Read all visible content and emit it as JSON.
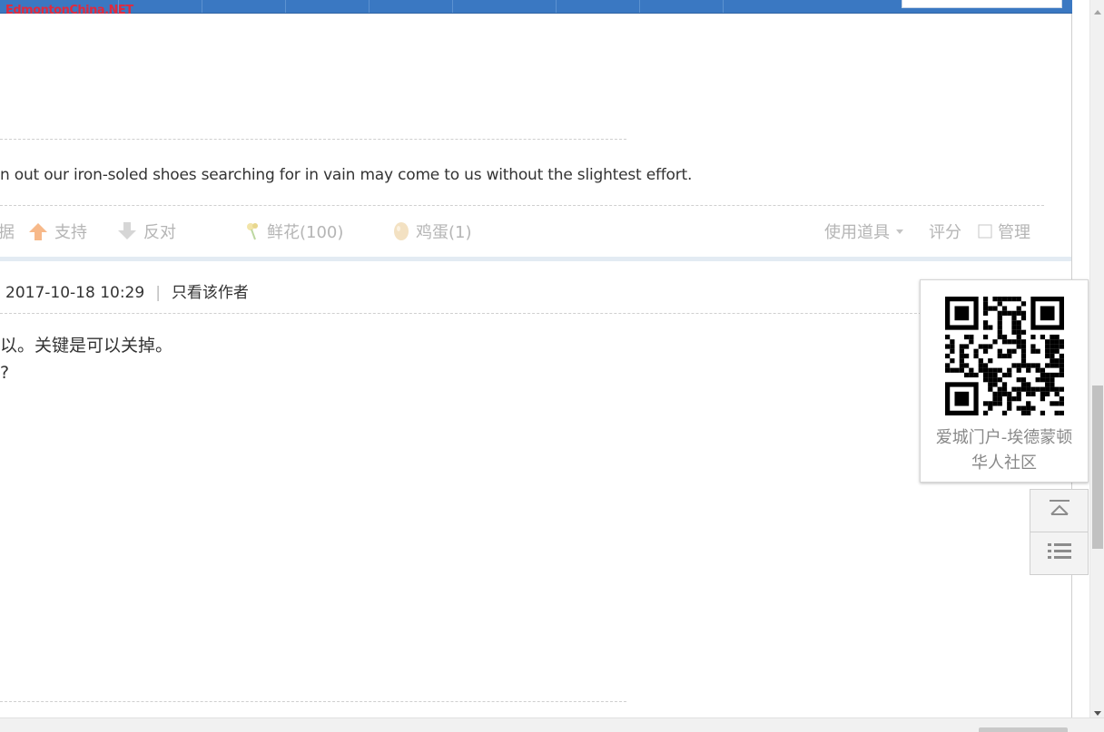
{
  "site": {
    "watermark": "EdmontonChina.NET"
  },
  "post": {
    "signature": "n out our iron-soled shoes searching for in vain may come to us without the slightest effort."
  },
  "actions": {
    "partial_label": "据",
    "support": "支持",
    "oppose": "反对",
    "flower": "鲜花(100)",
    "egg": "鸡蛋(1)",
    "tools": "使用道具",
    "rate": "评分",
    "manage": "管理"
  },
  "reply": {
    "datetime": "2017-10-18 10:29",
    "separator": "|",
    "author_only": "只看该作者",
    "line1": "以。关键是可以关掉。",
    "line2": "?"
  },
  "qr_panel": {
    "caption_line1": "爱城门户-埃德蒙顿",
    "caption_line2": "华人社区"
  },
  "colors": {
    "nav": "#3a78c2",
    "watermark": "#e02a3e",
    "support_arrow": "#f7b98a",
    "muted_text": "#b5b5b5"
  }
}
